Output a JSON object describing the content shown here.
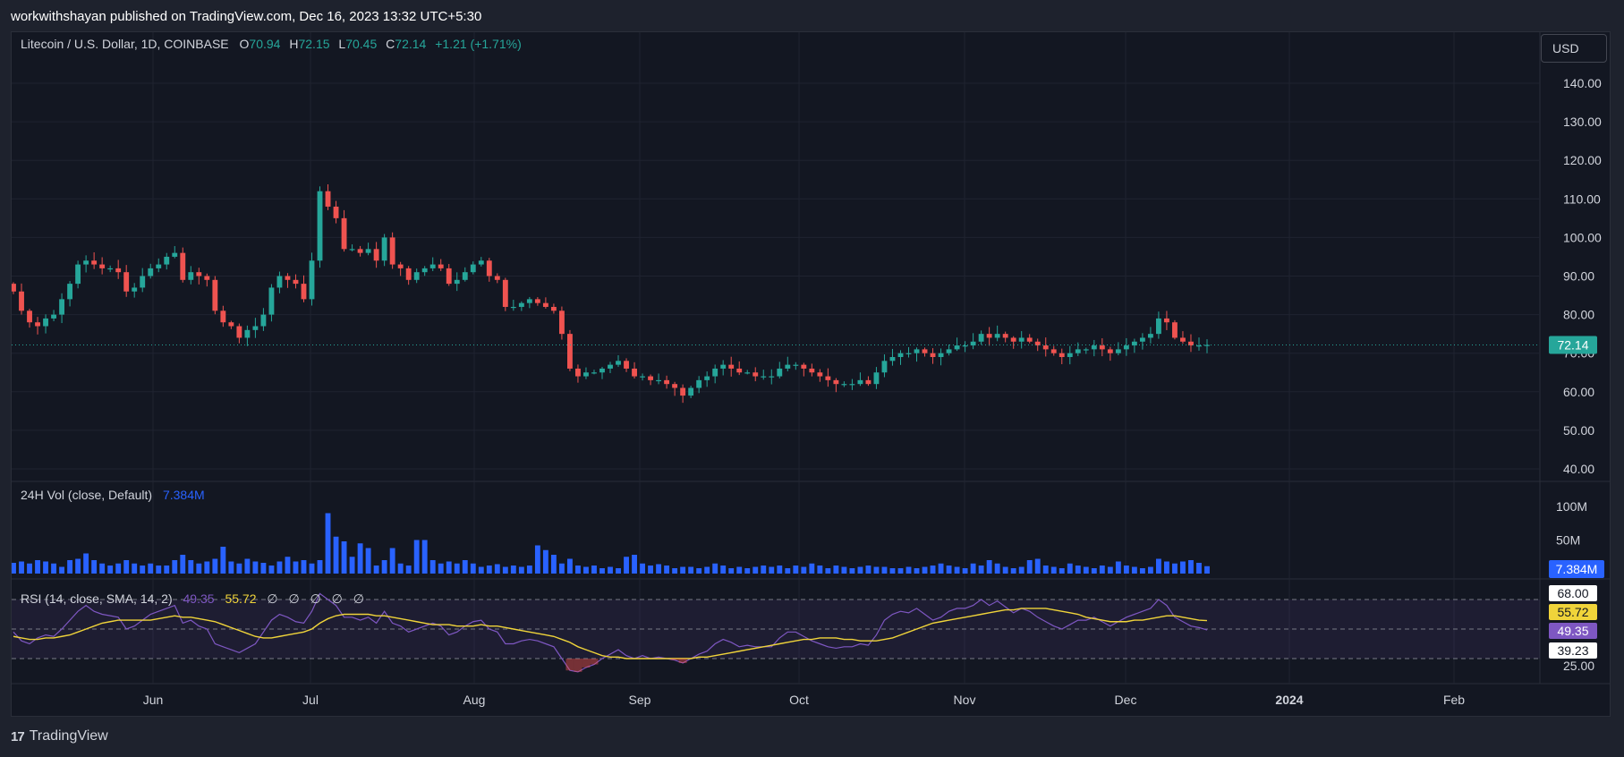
{
  "header": {
    "publisher": "workwithshayan published on TradingView.com, Dec 16, 2023 13:32 UTC+5:30",
    "symbol": "Litecoin / U.S. Dollar, 1D, COINBASE",
    "o_label": "O",
    "o_value": "70.94",
    "h_label": "H",
    "h_value": "72.15",
    "l_label": "L",
    "l_value": "70.45",
    "c_label": "C",
    "c_value": "72.14",
    "change": "+1.21 (+1.71%)"
  },
  "currency_button": "USD",
  "volume_legend": {
    "label": "24H Vol (close, Default)",
    "value": "7.384M"
  },
  "rsi_legend": {
    "label": "RSI (14, close, SMA, 14, 2)",
    "rsi": "49.35",
    "sma": "55.72",
    "extras": [
      "∅",
      "∅",
      "∅",
      "∅",
      "∅"
    ]
  },
  "footer": {
    "brand": "TradingView",
    "mark": "17"
  },
  "colors": {
    "up": "#26a69a",
    "down": "#ef5350",
    "volume": "#2962ff",
    "rsi": "#7e57c2",
    "sma": "#f0d43a"
  },
  "chart_data": [
    {
      "type": "candlestick",
      "title": "Litecoin / U.S. Dollar, 1D, COINBASE",
      "x_ticks": [
        "Jun",
        "Jul",
        "Aug",
        "Sep",
        "Oct",
        "Nov",
        "Dec",
        "2024",
        "Feb"
      ],
      "y_ticks": [
        "140.00",
        "130.00",
        "120.00",
        "110.00",
        "100.00",
        "90.00",
        "80.00",
        "70.00",
        "60.00",
        "50.00",
        "40.00"
      ],
      "ylim": [
        40,
        140
      ],
      "last_price": "72.14",
      "close": [
        86,
        81,
        78,
        77,
        79,
        80,
        84,
        88,
        93,
        94,
        93,
        92,
        92,
        91,
        86,
        87,
        90,
        92,
        93,
        95,
        96,
        89,
        91,
        90,
        89,
        81,
        78,
        77,
        74,
        76,
        77,
        80,
        87,
        90,
        89,
        88,
        84,
        94,
        112,
        108,
        105,
        97,
        97,
        96,
        97,
        94,
        100,
        93,
        92,
        89,
        91,
        92,
        93,
        92,
        88,
        89,
        91,
        93,
        94,
        90,
        89,
        82,
        82,
        83,
        84,
        83,
        82,
        81,
        75,
        66,
        64,
        65,
        65,
        66,
        67,
        68,
        66,
        64,
        64,
        63,
        63,
        62,
        61,
        59,
        61,
        63,
        64,
        66,
        67,
        66,
        65,
        65,
        64,
        64,
        64,
        66,
        67,
        67,
        66,
        65,
        64,
        63,
        62,
        62,
        62,
        63,
        62,
        65,
        68,
        69,
        70,
        70,
        71,
        70,
        69,
        70,
        71,
        72,
        72,
        73,
        75,
        74,
        75,
        74,
        73,
        74,
        73,
        72,
        71,
        70,
        69,
        70,
        71,
        71,
        72,
        71,
        70,
        71,
        72,
        73,
        74,
        75,
        79,
        78,
        74,
        73,
        72,
        72,
        72.14
      ],
      "volume_label": "24H Vol (close, Default)",
      "volume_ticks": [
        "100M",
        "50M"
      ],
      "volume_last": "7.384M",
      "volume": [
        16,
        18,
        15,
        20,
        18,
        15,
        10,
        20,
        22,
        30,
        20,
        15,
        12,
        15,
        20,
        15,
        12,
        15,
        12,
        12,
        20,
        28,
        20,
        15,
        18,
        22,
        40,
        18,
        15,
        22,
        18,
        16,
        12,
        18,
        25,
        18,
        20,
        15,
        20,
        90,
        55,
        48,
        25,
        45,
        38,
        12,
        20,
        38,
        15,
        12,
        50,
        50,
        20,
        15,
        18,
        15,
        20,
        15,
        10,
        12,
        14,
        10,
        12,
        10,
        12,
        42,
        35,
        28,
        15,
        22,
        12,
        10,
        12,
        8,
        10,
        8,
        25,
        28,
        15,
        12,
        14,
        12,
        8,
        10,
        10,
        8,
        10,
        15,
        12,
        8,
        10,
        8,
        10,
        12,
        10,
        12,
        8,
        12,
        10,
        15,
        12,
        8,
        12,
        10,
        8,
        10,
        12,
        10,
        10,
        8,
        8,
        10,
        8,
        10,
        12,
        15,
        12,
        10,
        8,
        15,
        12,
        20,
        15,
        10,
        8,
        10,
        20,
        22,
        12,
        10,
        8,
        15,
        12,
        10,
        8,
        12,
        10,
        18,
        12,
        10,
        8,
        10,
        22,
        18,
        15,
        18,
        20,
        16,
        11
      ],
      "rsi_label": "RSI (14, close, SMA, 14, 2)",
      "rsi_ticks": [
        "68.00",
        "55.72",
        "49.35",
        "39.23",
        "25.00"
      ],
      "rsi_bands": [
        70,
        50,
        30
      ],
      "rsi_ylim": [
        22,
        75
      ],
      "rsi": [
        48,
        42,
        40,
        44,
        46,
        45,
        50,
        56,
        62,
        66,
        62,
        60,
        59,
        58,
        50,
        52,
        56,
        60,
        62,
        64,
        66,
        54,
        56,
        52,
        50,
        40,
        38,
        36,
        34,
        37,
        40,
        48,
        56,
        60,
        58,
        55,
        54,
        62,
        74,
        70,
        66,
        58,
        58,
        56,
        58,
        54,
        62,
        54,
        52,
        48,
        50,
        52,
        54,
        52,
        46,
        48,
        52,
        55,
        56,
        50,
        48,
        40,
        40,
        42,
        43,
        42,
        40,
        38,
        30,
        22,
        21,
        24,
        26,
        30,
        33,
        36,
        32,
        30,
        32,
        30,
        31,
        30,
        29,
        27,
        30,
        33,
        35,
        40,
        43,
        41,
        38,
        39,
        38,
        38,
        38,
        44,
        48,
        48,
        45,
        42,
        40,
        38,
        37,
        38,
        38,
        40,
        39,
        46,
        56,
        60,
        62,
        61,
        64,
        60,
        56,
        58,
        62,
        64,
        64,
        66,
        70,
        66,
        69,
        65,
        61,
        64,
        62,
        58,
        55,
        52,
        50,
        53,
        56,
        56,
        58,
        55,
        52,
        55,
        58,
        60,
        62,
        64,
        70,
        66,
        58,
        55,
        52,
        51,
        49.35
      ],
      "sma": [
        45,
        44,
        43,
        43,
        44,
        44,
        45,
        46,
        48,
        50,
        52,
        54,
        55,
        56,
        56,
        56,
        56,
        56,
        57,
        58,
        59,
        58,
        58,
        57,
        56,
        55,
        53,
        51,
        49,
        47,
        45,
        44,
        44,
        45,
        46,
        47,
        48,
        50,
        54,
        57,
        59,
        60,
        60,
        60,
        60,
        59,
        59,
        58,
        57,
        56,
        55,
        54,
        53,
        53,
        53,
        52,
        52,
        52,
        53,
        52,
        52,
        51,
        50,
        49,
        48,
        47,
        46,
        45,
        43,
        41,
        38,
        36,
        34,
        32,
        31,
        31,
        30,
        30,
        30,
        30,
        30,
        30,
        30,
        30,
        30,
        31,
        31,
        32,
        33,
        34,
        35,
        36,
        37,
        38,
        39,
        40,
        41,
        42,
        43,
        43,
        44,
        44,
        44,
        43,
        43,
        42,
        42,
        42,
        43,
        44,
        46,
        48,
        50,
        52,
        54,
        55,
        56,
        57,
        58,
        59,
        60,
        61,
        62,
        63,
        63,
        64,
        64,
        64,
        64,
        63,
        62,
        61,
        60,
        58,
        57,
        56,
        55,
        55,
        55,
        56,
        56,
        57,
        58,
        59,
        59,
        58,
        57,
        56,
        55.72
      ],
      "rsi_last": "49.35",
      "sma_last": "55.72",
      "rsi_marker_a": "68.00",
      "rsi_marker_b": "39.23"
    }
  ]
}
